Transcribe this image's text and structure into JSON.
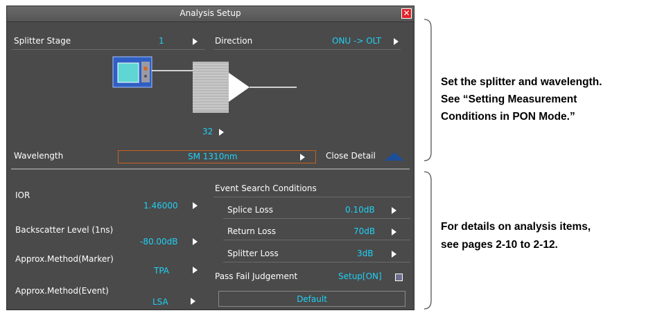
{
  "dialog": {
    "title": "Analysis Setup",
    "close_glyph": "✕"
  },
  "splitter": {
    "stage_label": "Splitter Stage",
    "stage_value": "1",
    "direction_label": "Direction",
    "direction_value": "ONU -> OLT",
    "ratio_value": "32"
  },
  "wavelength": {
    "label": "Wavelength",
    "value": "SM 1310nm",
    "close_detail_label": "Close Detail"
  },
  "analysis": {
    "ior_label": "IOR",
    "ior_value": "1.46000",
    "backscatter_label": "Backscatter Level (1ns)",
    "backscatter_value": "-80.00dB",
    "marker_label": "Approx.Method(Marker)",
    "marker_value": "TPA",
    "event_label": "Approx.Method(Event)",
    "event_value": "LSA"
  },
  "event_search": {
    "header": "Event Search Conditions",
    "splice_label": "Splice Loss",
    "splice_value": "0.10dB",
    "return_label": "Return Loss",
    "return_value": "70dB",
    "splitter_label": "Splitter Loss",
    "splitter_value": "3dB",
    "pass_fail_label": "Pass Fail Judgement",
    "pass_fail_value": "Setup[ON]",
    "default_label": "Default"
  },
  "annotations": {
    "top_line1": "Set the splitter and wavelength.",
    "top_line2": "See “Setting Measurement",
    "top_line3": "Conditions in PON Mode.”",
    "bottom_line1": "For details on analysis items,",
    "bottom_line2": "see pages 2-10 to 2-12."
  },
  "icons": [
    "close-icon",
    "right-arrow-icon",
    "triangle-up-icon",
    "otdr-device-icon",
    "splitter-icon",
    "setup-icon"
  ],
  "colors": {
    "panel_bg": "#4a4a4a",
    "value_text": "#1fd1f5",
    "wavelength_border": "#c8621c",
    "close_red": "#e0222a",
    "close_detail_triangle": "#1d4e9a"
  }
}
